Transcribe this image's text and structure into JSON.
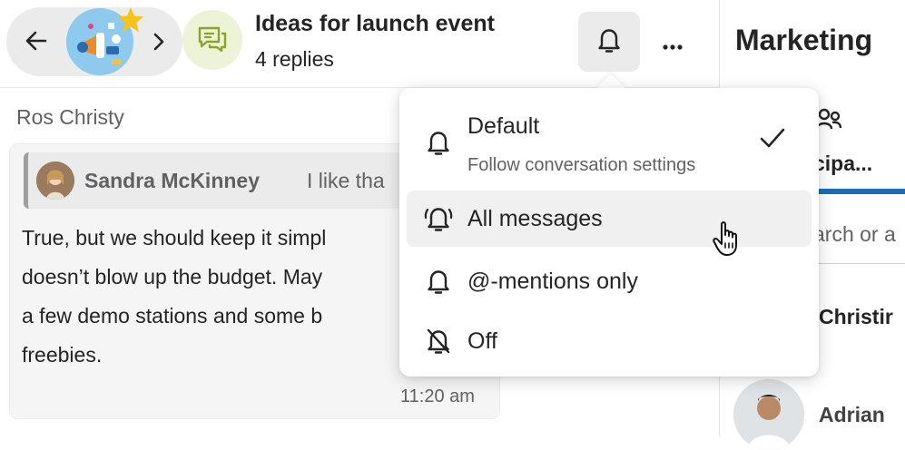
{
  "thread": {
    "title": "Ideas for launch event",
    "replies": "4 replies"
  },
  "message": {
    "sender": "Ros Christy",
    "quote_author": "Sandra McKinney",
    "quote_text": "I like tha",
    "lines": [
      "True, but we should keep it simpl",
      "doesn’t blow up the budget. May",
      "a few demo stations and some b",
      "freebies."
    ],
    "time": "11:20 am"
  },
  "right_pane": {
    "title": "Marketing",
    "tab_label": "cipa...",
    "search_placeholder": "arch or a",
    "people": [
      "Christir",
      "Adrian"
    ]
  },
  "notification_menu": {
    "items": [
      {
        "label": "Default",
        "description": "Follow conversation settings",
        "icon": "bell-icon",
        "selected": true
      },
      {
        "label": "All messages",
        "icon": "bell-ring-icon",
        "hovered": true
      },
      {
        "label": "@-mentions only",
        "icon": "bell-icon"
      },
      {
        "label": "Off",
        "icon": "bell-off-icon"
      }
    ]
  },
  "colors": {
    "accent": "#1b6cb8",
    "menu_hover": "#f0f0f0",
    "pill_bg": "#ebebeb"
  }
}
